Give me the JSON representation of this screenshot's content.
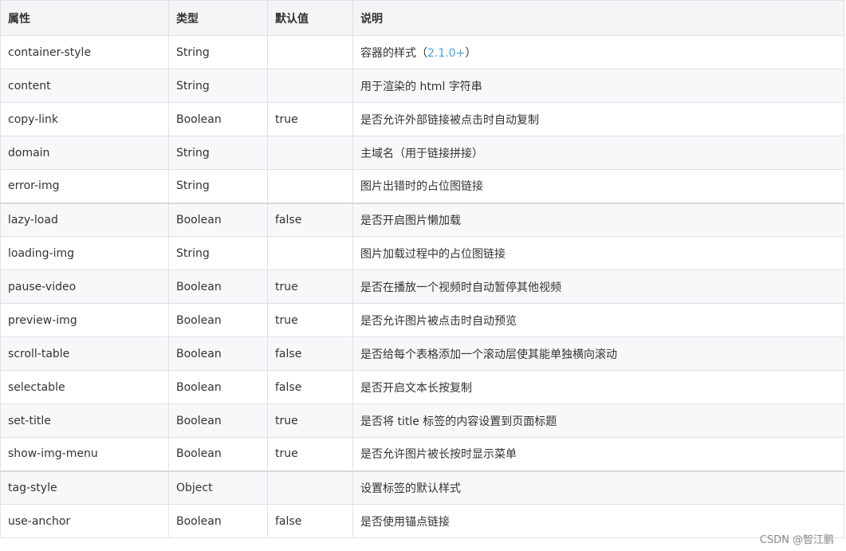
{
  "table": {
    "headers": [
      "属性",
      "类型",
      "默认值",
      "说明"
    ],
    "rows": [
      {
        "attr": "container-style",
        "type": "String",
        "default": "",
        "desc": "容器的样式（",
        "version": "2.1.0+",
        "desc_suffix": "）"
      },
      {
        "attr": "content",
        "type": "String",
        "default": "",
        "desc": "用于渲染的 html 字符串"
      },
      {
        "attr": "copy-link",
        "type": "Boolean",
        "default": "true",
        "desc": "是否允许外部链接被点击时自动复制"
      },
      {
        "attr": "domain",
        "type": "String",
        "default": "",
        "desc": "主域名（用于链接拼接）"
      },
      {
        "attr": "error-img",
        "type": "String",
        "default": "",
        "desc": "图片出错时的占位图链接"
      },
      {
        "attr": "lazy-load",
        "type": "Boolean",
        "default": "false",
        "desc": "是否开启图片懒加载"
      },
      {
        "attr": "loading-img",
        "type": "String",
        "default": "",
        "desc": "图片加载过程中的占位图链接"
      },
      {
        "attr": "pause-video",
        "type": "Boolean",
        "default": "true",
        "desc": "是否在播放一个视频时自动暂停其他视频"
      },
      {
        "attr": "preview-img",
        "type": "Boolean",
        "default": "true",
        "desc": "是否允许图片被点击时自动预览"
      },
      {
        "attr": "scroll-table",
        "type": "Boolean",
        "default": "false",
        "desc": "是否给每个表格添加一个滚动层使其能单独横向滚动"
      },
      {
        "attr": "selectable",
        "type": "Boolean",
        "default": "false",
        "desc": "是否开启文本长按复制"
      },
      {
        "attr": "set-title",
        "type": "Boolean",
        "default": "true",
        "desc": "是否将 title 标签的内容设置到页面标题"
      },
      {
        "attr": "show-img-menu",
        "type": "Boolean",
        "default": "true",
        "desc": "是否允许图片被长按时显示菜单"
      },
      {
        "attr": "tag-style",
        "type": "Object",
        "default": "",
        "desc": "设置标签的默认样式"
      },
      {
        "attr": "use-anchor",
        "type": "Boolean",
        "default": "false",
        "desc": "是否使用锚点链接"
      }
    ]
  },
  "watermark": "CSDN @智江鹏",
  "colors": {
    "header_bg": "#f3f5f7",
    "row_alt_bg": "#f6f8fa",
    "border": "#dfe2e5",
    "version_link": "#42a5e6",
    "text": "#333333"
  }
}
